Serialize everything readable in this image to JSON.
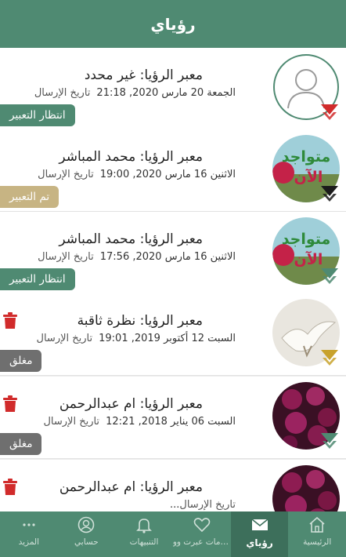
{
  "header": {
    "title": "رؤياي"
  },
  "cards": [
    {
      "title": "معبر الرؤيا: غير محدد",
      "sent_label": "تاريخ الإرسال",
      "date": "الجمعة 20 مارس 2020, 21:18",
      "status": "انتظار التعبير",
      "status_color": "#4f8a72",
      "avatar": "placeholder",
      "badge_color": "#d12b2b",
      "deletable": false
    },
    {
      "title": "معبر الرؤيا: محمد المباشر",
      "sent_label": "تاريخ الإرسال",
      "date": "الاثنين 16 مارس 2020, 19:00",
      "status": "تم التعبير",
      "status_color": "#c7b483",
      "avatar": "motawajed",
      "avatar_text": "متواجد الآن",
      "badge_color": "#1b1b1b",
      "deletable": false
    },
    {
      "title": "معبر الرؤيا: محمد المباشر",
      "sent_label": "تاريخ الإرسال",
      "date": "الاثنين 16 مارس 2020, 17:56",
      "status": "انتظار التعبير",
      "status_color": "#4f8a72",
      "avatar": "motawajed",
      "avatar_text": "متواجد الآن",
      "badge_color": "#4f8a72",
      "deletable": false
    },
    {
      "title": "معبر الرؤيا: نظرة ثاقبة",
      "sent_label": "تاريخ الإرسال",
      "date": "السبت 12 أكتوبر 2019, 19:01",
      "status": "مغلق",
      "status_color": "#6f6f6f",
      "avatar": "bird",
      "badge_color": "#c8a22c",
      "deletable": true
    },
    {
      "title": "معبر الرؤيا: ام عبدالرحمن",
      "sent_label": "تاريخ الإرسال",
      "date": "السبت 06 يناير 2018, 12:21",
      "status": "مغلق",
      "status_color": "#6f6f6f",
      "avatar": "roses",
      "badge_color": "#4f8a72",
      "deletable": true
    },
    {
      "title": "معبر الرؤيا: ام عبدالرحمن",
      "sent_label": "تاريخ الإرسال",
      "date": "...",
      "status": "",
      "status_color": "#6f6f6f",
      "avatar": "roses",
      "badge_color": "#4f8a72",
      "deletable": true
    }
  ],
  "nav": {
    "items": [
      {
        "label": "الرئيسية",
        "icon": "home-icon",
        "active": false
      },
      {
        "label": "رؤياي",
        "icon": "mail-icon",
        "active": true
      },
      {
        "label": "منامات عبرت وو...",
        "icon": "heart-icon",
        "active": false
      },
      {
        "label": "التنبيهات",
        "icon": "bell-icon",
        "active": false
      },
      {
        "label": "حسابي",
        "icon": "user-icon",
        "active": false
      },
      {
        "label": "المزيد",
        "icon": "more-icon",
        "active": false
      }
    ]
  },
  "colors": {
    "primary": "#4f8a72",
    "danger": "#d12b2b"
  }
}
